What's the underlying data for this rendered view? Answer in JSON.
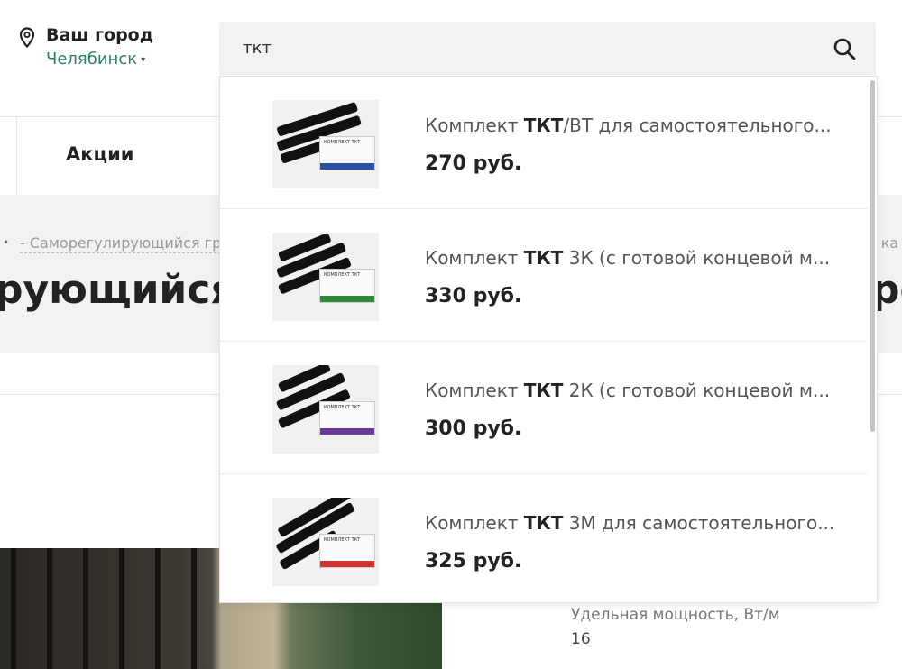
{
  "header": {
    "city_label": "Ваш город",
    "city_value": "Челябинск",
    "caret": "▾"
  },
  "search": {
    "value": "ткт",
    "icon": "search-icon"
  },
  "nav": {
    "akcii": "Акции"
  },
  "breadcrumb": {
    "dot": "•",
    "text": "- Саморегулирующийся гр",
    "right": "я ка"
  },
  "page": {
    "title_left": "рующийся",
    "title_right": "ре"
  },
  "specs": {
    "label": "Удельная мощность, Вт/м",
    "value": "16"
  },
  "suggestions": [
    {
      "prefix": "Комплект ",
      "highlight": "ТКТ",
      "rest": "/ВТ для самостоятельного...",
      "price": "270 руб.",
      "band_color": "#2a50a8"
    },
    {
      "prefix": "Комплект ",
      "highlight": "ТКТ",
      "rest": " 3К (с готовой концевой м...",
      "price": "330 руб.",
      "band_color": "#2e8a3a"
    },
    {
      "prefix": "Комплект ",
      "highlight": "ТКТ",
      "rest": " 2К (с готовой концевой м...",
      "price": "300 руб.",
      "band_color": "#6a3a9a"
    },
    {
      "prefix": "Комплект ",
      "highlight": "ТКТ",
      "rest": " 3М для самостоятельного...",
      "price": "325 руб.",
      "band_color": "#d23232"
    }
  ],
  "thumb_caption": "КОМПЛЕКТ ТКТ"
}
